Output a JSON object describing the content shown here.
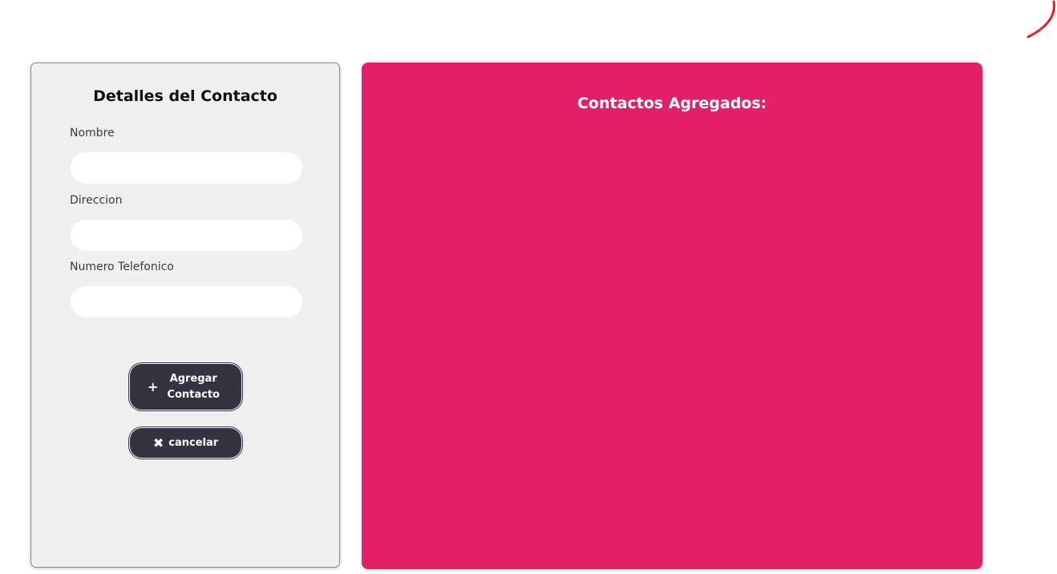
{
  "form": {
    "title": "Detalles del Contacto",
    "fields": [
      {
        "label": "Nombre",
        "value": "",
        "placeholder": ""
      },
      {
        "label": "Direccion",
        "value": "",
        "placeholder": ""
      },
      {
        "label": "Numero Telefonico",
        "value": "",
        "placeholder": ""
      }
    ],
    "add_button": {
      "icon": "plus-icon",
      "label": "Agregar Contacto"
    },
    "cancel_button": {
      "icon": "close-icon",
      "label": "cancelar"
    }
  },
  "contacts_panel": {
    "title": "Contactos Agregados:",
    "items": []
  },
  "colors": {
    "panel_bg": "#e22064",
    "form_bg": "#f0f0f0",
    "button_bg": "#323440",
    "corner_accent": "#e02020"
  }
}
